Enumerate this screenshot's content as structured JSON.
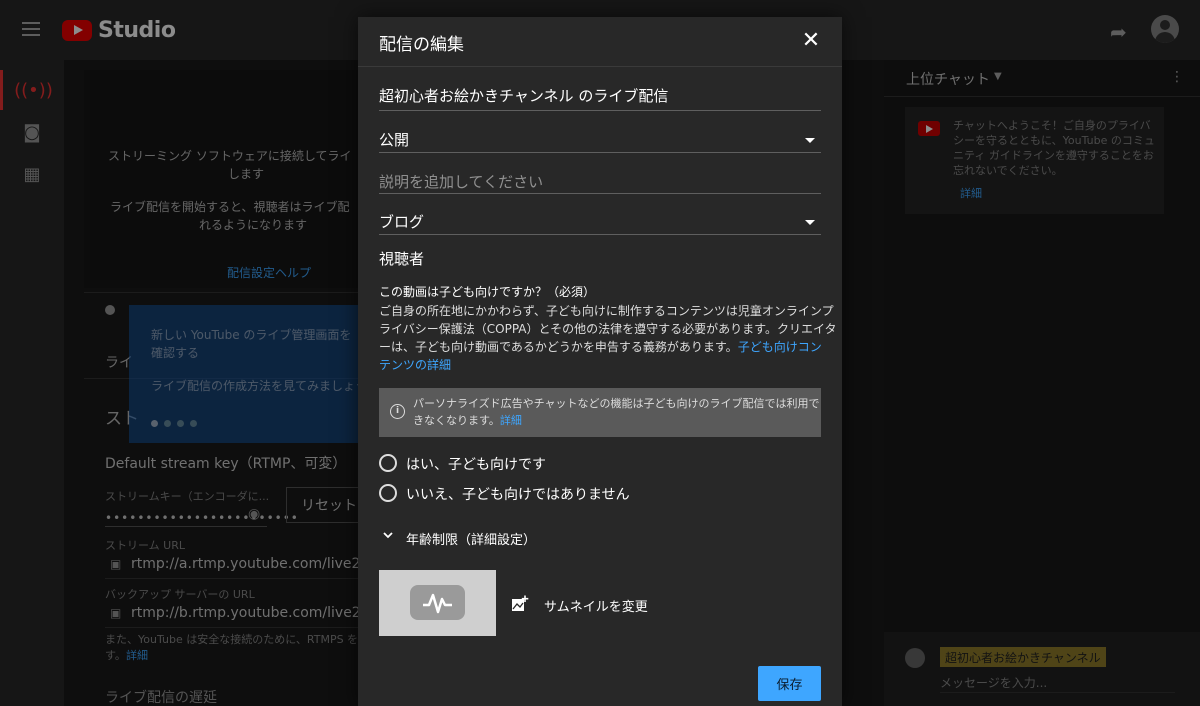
{
  "app": {
    "title": "Studio"
  },
  "background": {
    "stream_connect_line1": "ストリーミング ソフトウェアに接続してライ",
    "stream_connect_line2": "します",
    "start_live_line1": "ライブ配信を開始すると、視聴者はライブ配",
    "start_live_line2": "れるようになります",
    "settings_help_link": "配信設定ヘルプ",
    "tooltip_line1": "新しい YouTube のライブ管理画面を",
    "tooltip_line2": "確認する",
    "tooltip_line3": "ライブ配信の作成方法を見てみましょう",
    "tab_partial": "ライ",
    "section_partial": "スト",
    "stream_key_value": "Default stream key（RTMP、可変）",
    "stream_key_label": "ストリームキー（エンコーダに...",
    "stream_key_masked": "••••••••••••••••••••••••",
    "reset_label": "リセット",
    "stream_url_label": "ストリーム URL",
    "stream_url_value": "rtmp://a.rtmp.youtube.com/live2",
    "backup_url_label": "バックアップ サーバーの URL",
    "backup_url_value": "rtmp://b.rtmp.youtube.com/live2'",
    "rtmps_note_line1": "また、YouTube は安全な接続のために、RTMPS をサ",
    "rtmps_note_line2": "す。",
    "rtmps_detail_link": "詳細",
    "latency_partial": "ライブ配信の遅延"
  },
  "chat": {
    "header": "上位チャット",
    "welcome_line1": "チャットへようこそ！ご自身のプライバ",
    "welcome_line2": "シーを守るとともに、YouTube のコミュ",
    "welcome_line3": "ニティ ガイドラインを遵守することをお",
    "welcome_line4": "忘れないでください。",
    "welcome_link": "詳細",
    "channel_name": "超初心者お絵かきチャンネル",
    "input_placeholder": "メッセージを入力..."
  },
  "modal": {
    "title": "配信の編集",
    "stream_title": "超初心者お絵かきチャンネル のライブ配信",
    "visibility": "公開",
    "description_placeholder": "説明を追加してください",
    "category": "ブログ",
    "audience_heading": "視聴者",
    "kids_question": "この動画は子ども向けですか？（必須）",
    "kids_desc_line1": "ご自身の所在地にかかわらず、子ども向けに制作するコンテンツは児童オンラインプ",
    "kids_desc_line2": "ライバシー保護法（COPPA）とその他の法律を遵守する必要があります。クリエイタ",
    "kids_desc_line3": "ーは、子ども向け動画であるかどうかを申告する義務があります。",
    "kids_desc_link_a": "子ども向けコン",
    "kids_desc_link_b": "テンツの詳細",
    "info_line1": "パーソナライズド広告やチャットなどの機能は子ども向けのライブ配信では利用で",
    "info_line2": "きなくなります。",
    "info_link": "詳細",
    "radio_yes": "はい、子ども向けです",
    "radio_no": "いいえ、子ども向けではありません",
    "age_restriction": "年齢制限（詳細設定）",
    "change_thumbnail": "サムネイルを変更",
    "save": "保存"
  },
  "colors": {
    "accent": "#3ea6ff",
    "brand_red": "#ff0000",
    "modal_bg": "#282828"
  },
  "icons": [
    "menu-icon",
    "close-icon",
    "info-icon",
    "chevron-down-icon",
    "add-photo-icon",
    "share-icon",
    "avatar"
  ]
}
